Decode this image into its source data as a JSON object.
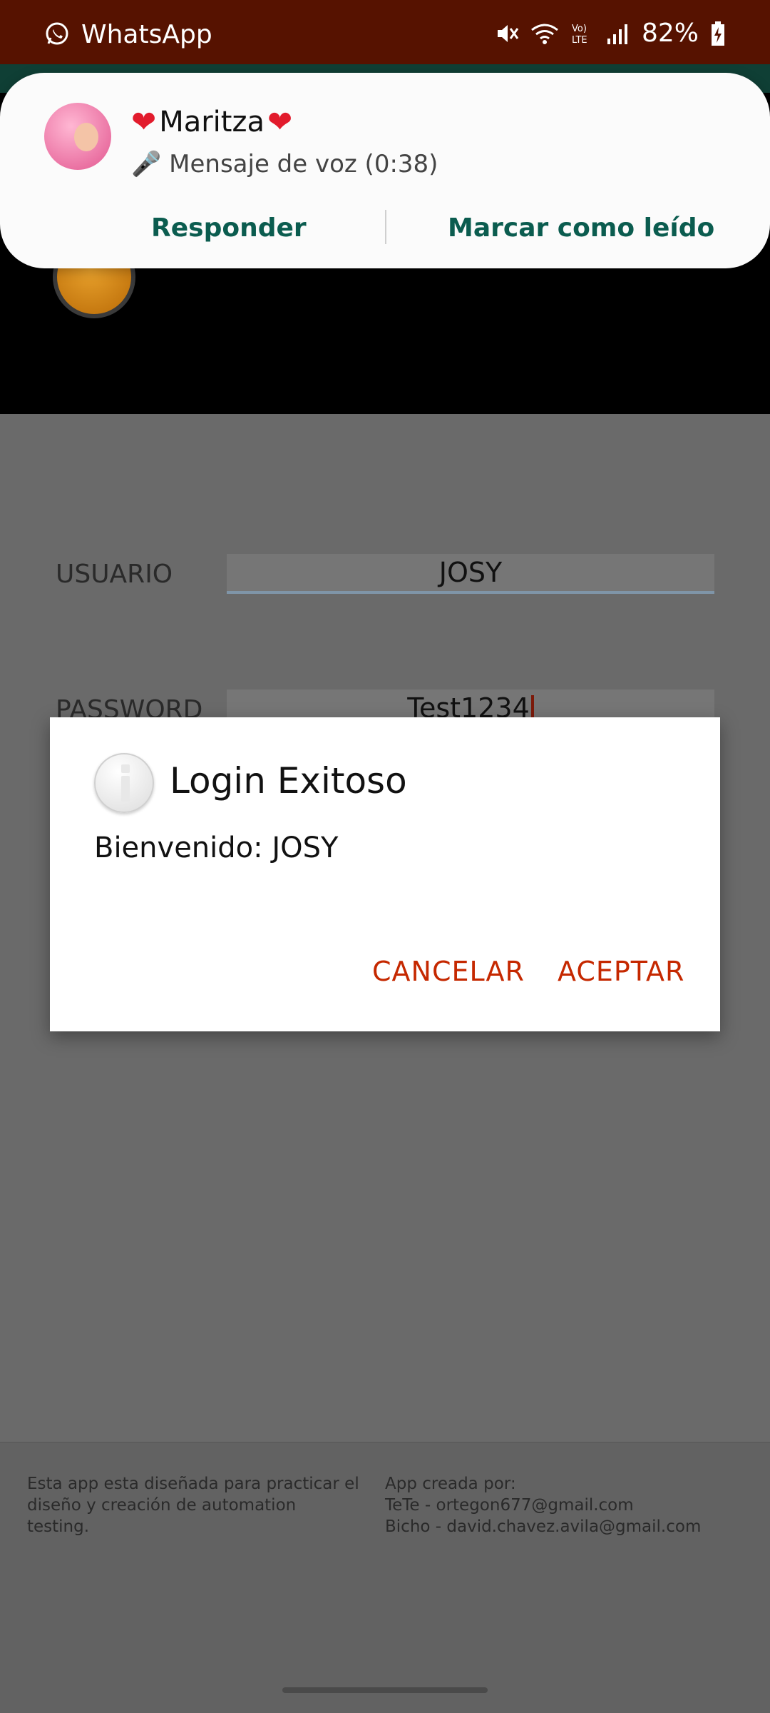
{
  "status_bar": {
    "app_name": "WhatsApp",
    "battery": "82%",
    "icons": [
      "whatsapp-icon",
      "mute-icon",
      "wifi-icon",
      "volte-icon",
      "signal-icon",
      "battery-charging-icon"
    ],
    "volte_label": "Vo) LTE"
  },
  "notification": {
    "sender": "Maritza",
    "message": "🎤 Mensaje de voz (0:38)",
    "actions": {
      "reply": "Responder",
      "mark_read": "Marcar como leído"
    },
    "heart_glyph": "❤"
  },
  "form": {
    "user_label": "USUARIO",
    "user_value": "JOSY",
    "password_label": "PASSWORD",
    "password_value": "Test1234"
  },
  "dialog": {
    "title": "Login Exitoso",
    "message": "Bienvenido: JOSY",
    "cancel_label": "CANCELAR",
    "accept_label": "ACEPTAR"
  },
  "footer": {
    "description": "Esta app esta diseñada para practicar el diseño y creación de automation testing.",
    "credits_title": "App creada por:",
    "credit_1": "TeTe - ortegon677@gmail.com",
    "credit_2": "Bicho - david.chavez.avila@gmail.com"
  },
  "colors": {
    "status_bar": "#561200",
    "accent_dialog": "#c52800",
    "notif_action": "#0b5c4f",
    "scrim": "#6a6a6a"
  }
}
